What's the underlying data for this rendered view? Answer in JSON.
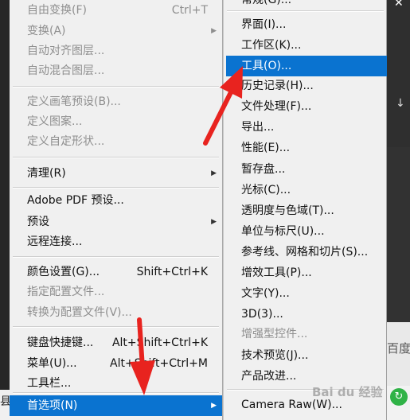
{
  "colors": {
    "menu_bg": "#f0f0f0",
    "highlight": "#0a73d0",
    "disabled_text": "#8e8e8e",
    "annotation_red": "#e8231f"
  },
  "edit_menu": {
    "items": [
      {
        "label": "自由变换(F)",
        "shortcut": "Ctrl+T",
        "disabled": true
      },
      {
        "label": "变换(A)",
        "submenu": true,
        "disabled": true
      },
      {
        "label": "自动对齐图层...",
        "disabled": true
      },
      {
        "label": "自动混合图层...",
        "disabled": true
      },
      {
        "label": "定义画笔预设(B)...",
        "disabled": true
      },
      {
        "label": "定义图案...",
        "disabled": true
      },
      {
        "label": "定义自定形状...",
        "disabled": true
      },
      {
        "label": "清理(R)",
        "submenu": true
      },
      {
        "label": "Adobe PDF 预设..."
      },
      {
        "label": "预设",
        "submenu": true
      },
      {
        "label": "远程连接..."
      },
      {
        "label": "颜色设置(G)...",
        "shortcut": "Shift+Ctrl+K"
      },
      {
        "label": "指定配置文件...",
        "disabled": true
      },
      {
        "label": "转换为配置文件(V)...",
        "disabled": true
      },
      {
        "label": "键盘快捷键...",
        "shortcut": "Alt+Shift+Ctrl+K"
      },
      {
        "label": "菜单(U)...",
        "shortcut": "Alt+Shift+Ctrl+M"
      },
      {
        "label": "工具栏..."
      },
      {
        "label": "首选项(N)",
        "submenu": true,
        "highlighted": true
      }
    ]
  },
  "preferences_submenu": {
    "items": [
      {
        "label": "常规(G)..."
      },
      {
        "label": "界面(I)..."
      },
      {
        "label": "工作区(K)..."
      },
      {
        "label": "工具(O)...",
        "highlighted": true
      },
      {
        "label": "历史记录(H)..."
      },
      {
        "label": "文件处理(F)..."
      },
      {
        "label": "导出..."
      },
      {
        "label": "性能(E)..."
      },
      {
        "label": "暂存盘..."
      },
      {
        "label": "光标(C)..."
      },
      {
        "label": "透明度与色域(T)..."
      },
      {
        "label": "单位与标尺(U)..."
      },
      {
        "label": "参考线、网格和切片(S)..."
      },
      {
        "label": "增效工具(P)..."
      },
      {
        "label": "文字(Y)..."
      },
      {
        "label": "3D(3)..."
      },
      {
        "label": "增强型控件...",
        "disabled": true
      },
      {
        "label": "技术预览(J)..."
      },
      {
        "label": "产品改进..."
      },
      {
        "label": "Camera Raw(W)..."
      }
    ]
  },
  "background": {
    "close_glyph": "✕",
    "down_arrow_glyph": "↓",
    "edge_text": "百度",
    "left_edge_glyph": "县",
    "green_button_glyph": "↻"
  },
  "watermark": "Bai du 经验",
  "icons": {
    "submenu_arrow": "▶"
  }
}
